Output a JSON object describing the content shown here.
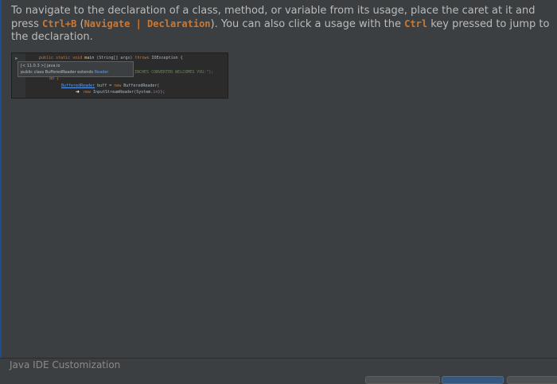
{
  "tip": {
    "p1": "To navigate to the declaration of a class, method, or variable from its usage, place the caret at it and press ",
    "kbd1": "Ctrl+B",
    "p2": " (",
    "kbd2": "Navigate | Declaration",
    "p3": "). You can also click a usage with the ",
    "kbd3": "Ctrl",
    "p4": " key pressed to jump to the declaration."
  },
  "snippet": {
    "line1": {
      "kw1": "public static void ",
      "name": "main",
      "rest": " (String[] args) ",
      "kw2": "throws",
      "rest2": " IOException {"
    },
    "line2": {
      "str": "INCHES CONVERTER WELCOMES YOU:\");"
    },
    "line3": {
      "kw": "do {"
    },
    "line4": {
      "link": "BufferedReader",
      "rest": " buff = ",
      "kw": "new",
      "rest2": " BufferedReader("
    },
    "line5": {
      "kw": "new",
      "rest": " InputStreamReader(System.",
      "field": "in",
      "rest2": "));"
    },
    "popup": {
      "line1": "[< 11.0.3 >] java.io",
      "line2a": "public class BufferedReader extends ",
      "line2b": "Reader"
    }
  },
  "footer": {
    "title": "Java IDE Customization"
  },
  "colors": {
    "background": "#3c3f41",
    "keyword": "#cc7832",
    "link": "#589df6",
    "accent": "#365880"
  }
}
